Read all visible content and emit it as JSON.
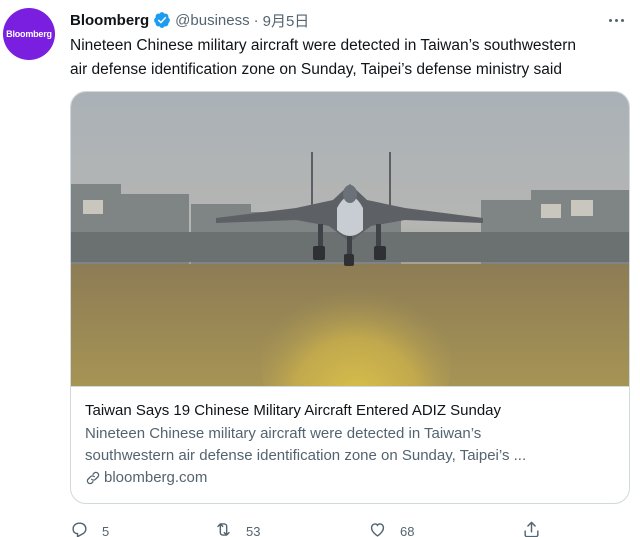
{
  "tweet": {
    "avatar_text": "Bloomberg",
    "display_name": "Bloomberg",
    "handle": "@business",
    "separator": "·",
    "time": "9月5日",
    "lines": [
      "Nineteen Chinese military aircraft were detected in Taiwan’s southwestern",
      "air defense identification zone on Sunday, Taipei’s defense ministry said"
    ]
  },
  "card": {
    "title": "Taiwan Says 19 Chinese Military Aircraft Entered ADIZ Sunday",
    "description_lines": [
      "Nineteen Chinese military aircraft were detected in Taiwan’s",
      "southwestern air defense identification zone on Sunday, Taipei’s ..."
    ],
    "domain": "bloomberg.com"
  },
  "actions": {
    "reply_count": "5",
    "retweet_count": "53",
    "like_count": "68"
  },
  "colors": {
    "brand_avatar": "#7a1fe0",
    "verified": "#1d9bf0",
    "secondary_text": "#536471",
    "border": "#cfd9de"
  },
  "icons": [
    "verified-badge-icon",
    "more-icon",
    "link-icon",
    "reply-icon",
    "retweet-icon",
    "like-icon",
    "share-icon"
  ]
}
